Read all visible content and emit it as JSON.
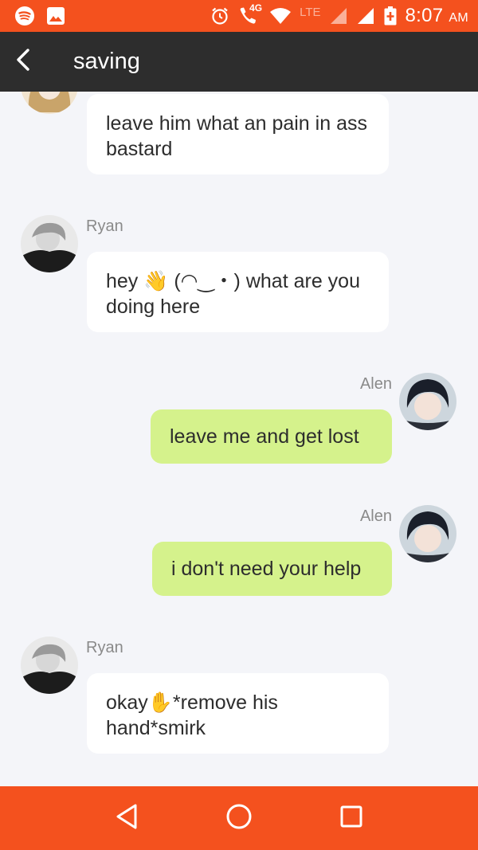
{
  "status_bar": {
    "time": "8:07",
    "ampm": "AM",
    "network": "4G",
    "lte": "LTE",
    "icons": [
      "spotify-icon",
      "gallery-icon",
      "alarm-icon",
      "call-4g-icon",
      "wifi-icon",
      "signal-icon",
      "signal-icon",
      "battery-charging-icon"
    ],
    "color": "#f4511e"
  },
  "toolbar": {
    "title": "saving",
    "back_icon": "chevron-left-icon",
    "color": "#2d2d2d"
  },
  "messages": [
    {
      "sender": "",
      "side": "incoming",
      "text": "leave him what an pain in ass bastard"
    },
    {
      "sender": "Ryan",
      "side": "incoming",
      "text": "hey 👋 (◠‿・) what are you doing here"
    },
    {
      "sender": "Alen",
      "side": "outgoing",
      "text": "leave me and get lost"
    },
    {
      "sender": "Alen",
      "side": "outgoing",
      "text": "i don't need your help"
    },
    {
      "sender": "Ryan",
      "side": "incoming",
      "text": "okay✋*remove his hand*smirk"
    }
  ],
  "colors": {
    "incoming_bubble": "#ffffff",
    "outgoing_bubble": "#d5f28c",
    "background": "#f4f5f9"
  },
  "nav_bar": {
    "icons": [
      "back-triangle-icon",
      "home-circle-icon",
      "recents-square-icon"
    ],
    "color": "#f4511e"
  }
}
